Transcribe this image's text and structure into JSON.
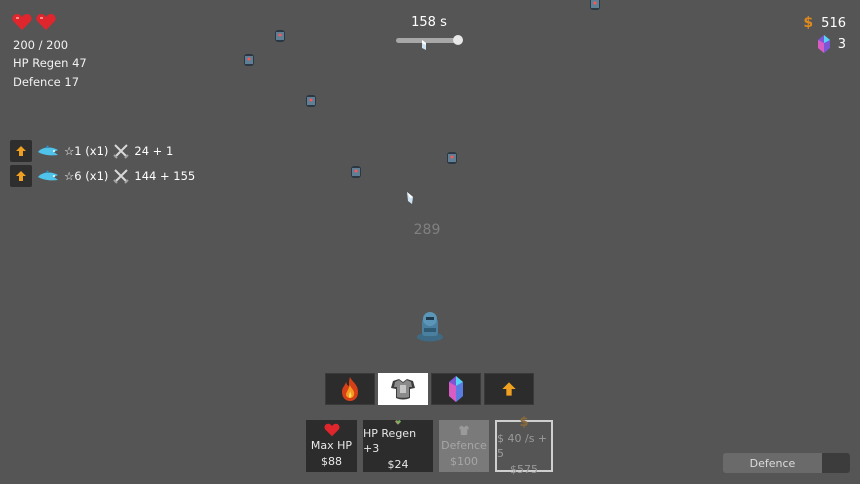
{
  "player": {
    "hp_text": "200 / 200",
    "hp_regen_text": "HP Regen 47",
    "defence_text": "Defence 17",
    "hearts": [
      "heart-icon",
      "heart-icon"
    ]
  },
  "timer": {
    "text": "158 s"
  },
  "resources": {
    "money": "516",
    "gems": "3"
  },
  "weapons": [
    {
      "level": "☆1 (x1)",
      "damage": "24 + 1",
      "icon": "shark-weapon-icon"
    },
    {
      "level": "☆6 (x1)",
      "damage": "144 + 155",
      "icon": "shark-weapon-icon"
    }
  ],
  "damage_popup": "289",
  "tabs": [
    {
      "icon": "fire-icon",
      "active": false
    },
    {
      "icon": "armor-icon",
      "active": true
    },
    {
      "icon": "crystal-icon",
      "active": false
    },
    {
      "icon": "arrow-up-icon",
      "active": false
    }
  ],
  "shop": {
    "max_hp": {
      "label": "Max HP",
      "price": "$88"
    },
    "hp_regen": {
      "label": "HP Regen +3",
      "price": "$24"
    },
    "defence": {
      "label": "Defence",
      "price": "$100"
    },
    "income": {
      "label": "$ 40 /s + 5",
      "price": "$575"
    }
  },
  "mode_toggle": {
    "label": "Defence"
  },
  "colors": {
    "background": "#555555",
    "accent_money": "#e08a1e",
    "heart": "#e0262d"
  }
}
